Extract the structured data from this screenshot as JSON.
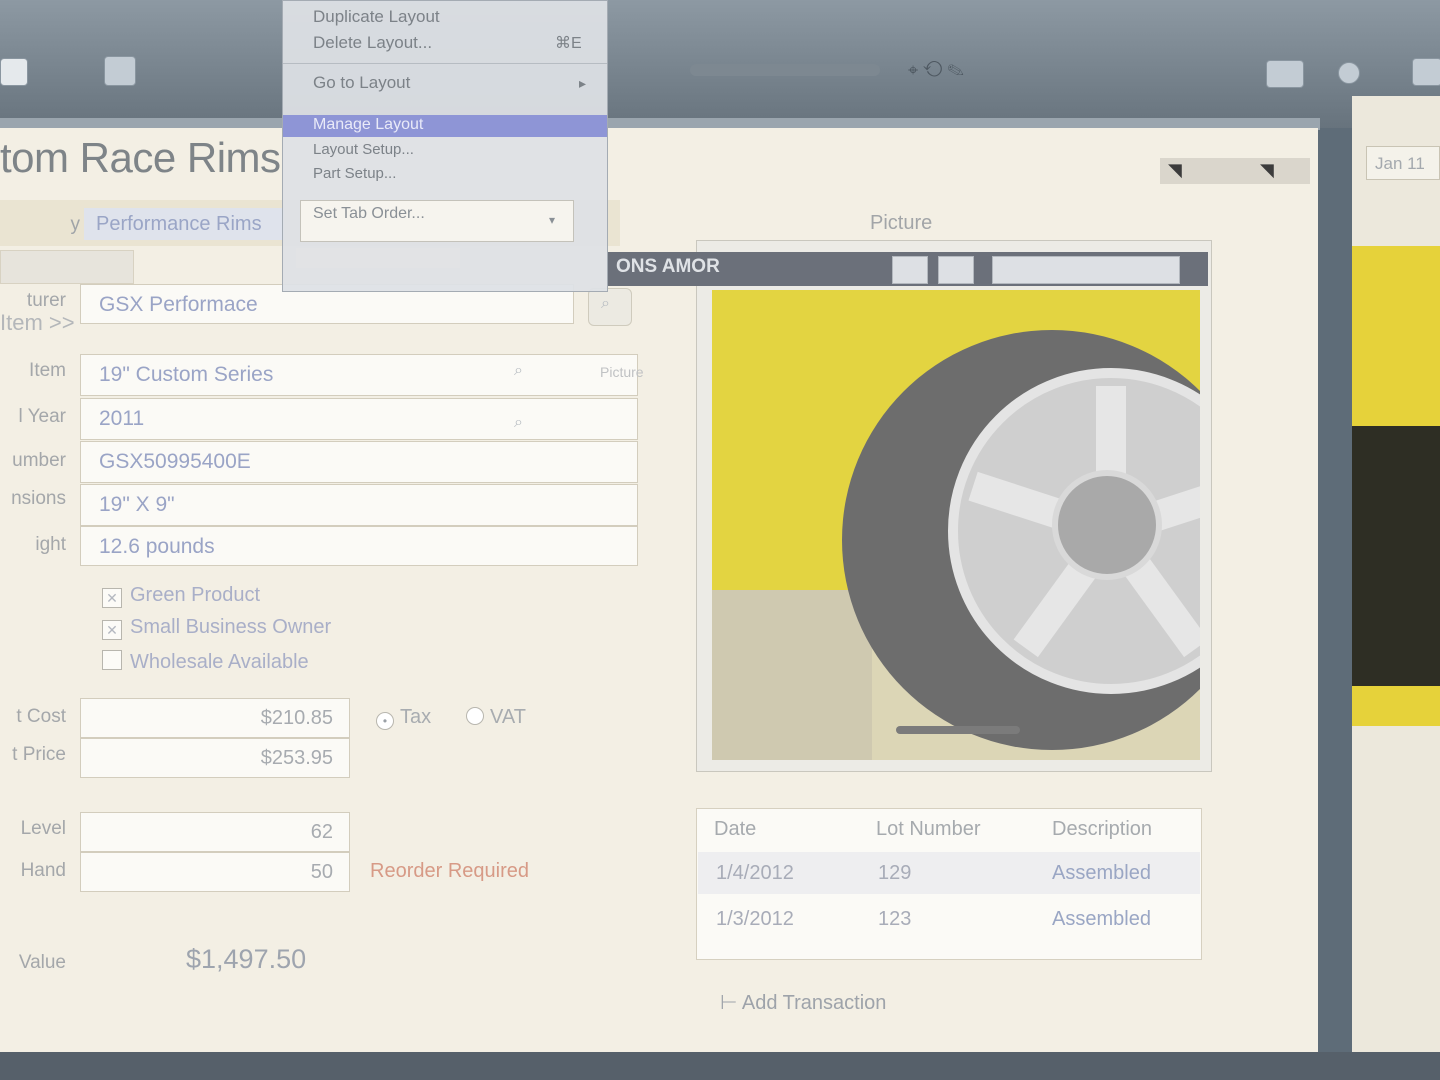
{
  "menu": {
    "items": [
      "Duplicate Layout",
      "Delete Layout...",
      "Go to Layout",
      "Manage Layout",
      "Layout Setup...",
      "Part Setup...",
      "Set Tab Order..."
    ],
    "shortcut": "⌘E",
    "submenu_arrow": "▸"
  },
  "record": {
    "title": "tom Race Rims",
    "tab_category": "y",
    "tab_active": "Performance Rims",
    "manufacturer_label": "turer",
    "manufacturer": "GSX Performace",
    "item_breadcrumb": "Item >>",
    "item_label": "Item",
    "item": "19\" Custom Series",
    "year_label": "l Year",
    "year": "2011",
    "number_label": "umber",
    "number": "GSX50995400E",
    "dimensions_label": "nsions",
    "dimensions": "19\" X 9\"",
    "weight_label": "ight",
    "weight": "12.6 pounds"
  },
  "checkboxes": [
    {
      "label": "Green Product",
      "mark": "✕"
    },
    {
      "label": "Small Business Owner",
      "mark": "✕"
    },
    {
      "label": "Wholesale Available",
      "mark": ""
    }
  ],
  "pricing": {
    "cost_label": "t Cost",
    "cost": "$210.85",
    "price_label": "t Price",
    "price": "$253.95",
    "tax_label": "Tax",
    "vat_label": "VAT"
  },
  "inventory": {
    "level_label": "Level",
    "level": "62",
    "onhand_label": "Hand",
    "onhand": "50",
    "reorder_text": "Reorder Required",
    "value_label": "Value",
    "value": "$1,497.50"
  },
  "picture": {
    "label": "Picture",
    "bar_text": "ONS AMOR"
  },
  "transactions": {
    "headers": [
      "Date",
      "Lot Number",
      "Description"
    ],
    "rows": [
      [
        "1/4/2012",
        "129",
        "Assembled"
      ],
      [
        "1/3/2012",
        "123",
        "Assembled"
      ]
    ],
    "add_label": "Add Transaction"
  },
  "back_window": {
    "date": "Jan 11"
  },
  "colors": {
    "toolbar": "#67737d",
    "window_bg": "#f3efe4",
    "menu_highlight": "#8e95d6",
    "reorder": "#d79a86",
    "car_yellow": "#e3d441"
  }
}
